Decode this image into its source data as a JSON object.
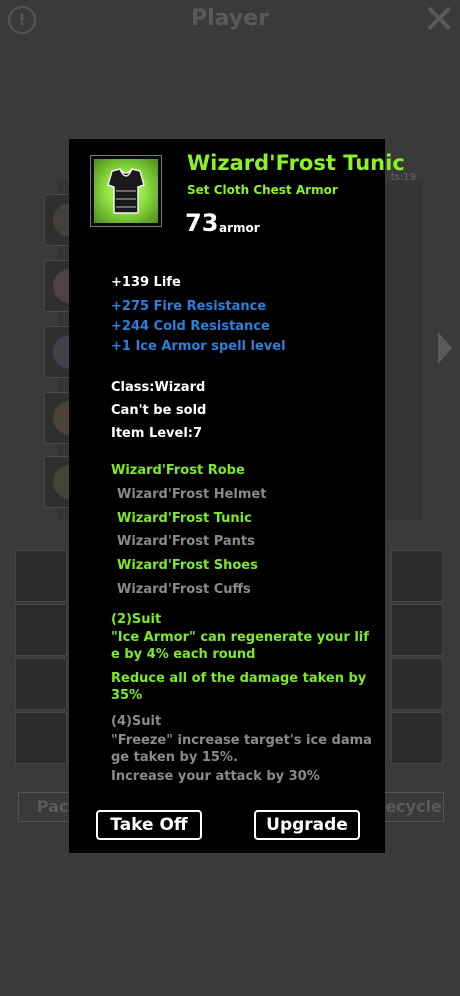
{
  "background": {
    "title": "Player",
    "stat_fragment": "ts:19",
    "pack_label": "Pack",
    "recycle_label": "Recycle"
  },
  "item": {
    "name": "Wizard'Frost Tunic",
    "type": "Set Cloth Chest Armor",
    "armor_value": "73",
    "armor_label": "armor",
    "life": "+139 Life",
    "bonuses": [
      "+275 Fire Resistance",
      "+244 Cold Resistance",
      "+1 Ice Armor spell level"
    ],
    "class": "Class:Wizard",
    "sell": "Can't be sold",
    "level": "Item Level:7"
  },
  "set": {
    "name": "Wizard'Frost Robe",
    "pieces": [
      {
        "label": "Wizard'Frost Helmet",
        "owned": false
      },
      {
        "label": "Wizard'Frost Tunic",
        "owned": true
      },
      {
        "label": "Wizard'Frost Pants",
        "owned": false
      },
      {
        "label": "Wizard'Frost Shoes",
        "owned": true
      },
      {
        "label": "Wizard'Frost Cuffs",
        "owned": false
      }
    ],
    "suit2_title": "(2)Suit",
    "suit2_line1": " \"Ice Armor\" can regenerate your life by 4% each round",
    "suit2_line2": "  Reduce all of the damage taken by 35%",
    "suit4_title": "(4)Suit",
    "suit4_line1": " \"Freeze\" increase target's ice damage taken by 15%.",
    "suit4_line2": "  Increase your attack by 30%"
  },
  "buttons": {
    "take_off": "Take Off",
    "upgrade": "Upgrade"
  },
  "colors": {
    "set_green": "#8cf02a",
    "bonus_blue": "#2f7fd8",
    "inactive_gray": "#8a8a8a"
  }
}
